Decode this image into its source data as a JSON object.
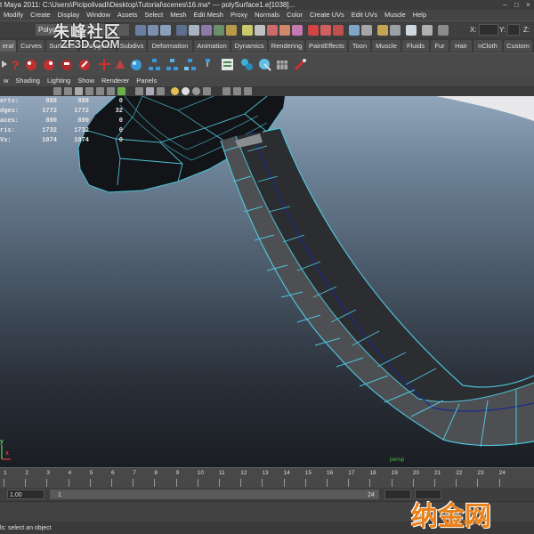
{
  "titlebar": {
    "text": "t Maya 2011: C:\\Users\\Picipolivadi\\Desktop\\Tutorial\\scenes\\16.ma*   ---   polySurface1.e[1038]...",
    "minimize": "–",
    "maximize": "□",
    "close": "×"
  },
  "menubar": [
    "Modify",
    "Create",
    "Display",
    "Window",
    "Assets",
    "Select",
    "Mesh",
    "Edit Mesh",
    "Proxy",
    "Normals",
    "Color",
    "Create UVs",
    "Edit UVs",
    "Muscle",
    "Help"
  ],
  "statusline": {
    "mode": "Polygons",
    "x_label": "X:",
    "y_label": "Y:",
    "z_label": "Z:"
  },
  "shelf_tabs": [
    "eral",
    "Curves",
    "Surfaces",
    "Polygons",
    "Subdivs",
    "Deformation",
    "Animation",
    "Dynamics",
    "Rendering",
    "PaintEffects",
    "Toon",
    "Muscle",
    "Fluids",
    "Fur",
    "Hair",
    "nCloth",
    "Custom"
  ],
  "shelf_active_tab": "eral",
  "panel_menu": [
    "w",
    "Shading",
    "Lighting",
    "Show",
    "Renderer",
    "Panels"
  ],
  "hud": {
    "rows": [
      {
        "label": "erts:",
        "v1": "888",
        "v2": "888",
        "v3": "0"
      },
      {
        "label": "dges:",
        "v1": "1772",
        "v2": "1772",
        "v3": "32"
      },
      {
        "label": "aces:",
        "v1": "890",
        "v2": "890",
        "v3": "0"
      },
      {
        "label": "ris:",
        "v1": "1732",
        "v2": "1732",
        "v3": "0"
      },
      {
        "label": "Vs:",
        "v1": "1074",
        "v2": "1074",
        "v3": "0"
      }
    ]
  },
  "viewport": {
    "camera_label": "persp",
    "axis_y": "y",
    "axis_x": "x",
    "wire_color": "#4fc3d9",
    "curve_color": "#1a2a8c"
  },
  "time_slider": {
    "ticks": [
      "1",
      "2",
      "3",
      "4",
      "5",
      "6",
      "7",
      "8",
      "9",
      "10",
      "11",
      "12",
      "13",
      "14",
      "15",
      "16",
      "17",
      "18",
      "19",
      "20",
      "21",
      "22",
      "23",
      "24"
    ]
  },
  "range": {
    "start_time": "1.00",
    "range_start": "1",
    "range_end": "24"
  },
  "helpline": "ls: select an object",
  "watermarks": {
    "top_cn": "朱峰社区",
    "top_en": "ZF3D.COM",
    "bottom_cn": "纳金网",
    "bottom_en": "NARKII.COM"
  }
}
